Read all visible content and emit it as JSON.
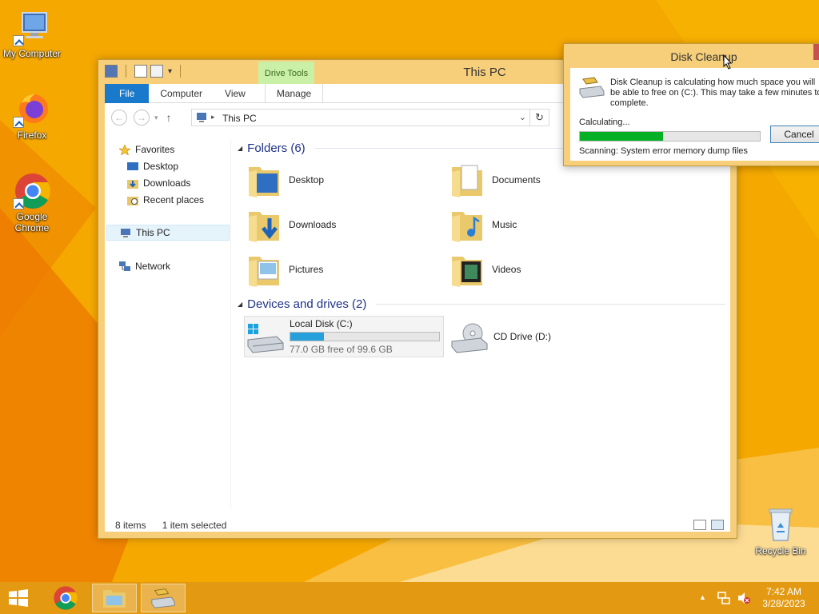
{
  "desktop": {
    "icons": [
      {
        "label": "My Computer",
        "icon": "computer-icon"
      },
      {
        "label": "Firefox",
        "icon": "firefox-icon"
      },
      {
        "label": "Google Chrome",
        "icon": "chrome-icon"
      },
      {
        "label": "Recycle Bin",
        "icon": "recycle-bin-icon"
      }
    ]
  },
  "explorer": {
    "title": "This PC",
    "contextual_tab": "Drive Tools",
    "ribbon_tabs": [
      "File",
      "Computer",
      "View",
      "Manage"
    ],
    "address": {
      "crumb": "This PC"
    },
    "nav": {
      "favorites": "Favorites",
      "favorite_items": [
        "Desktop",
        "Downloads",
        "Recent places"
      ],
      "this_pc": "This PC",
      "network": "Network"
    },
    "folders_header": "Folders (6)",
    "folders": [
      "Desktop",
      "Documents",
      "Downloads",
      "Music",
      "Pictures",
      "Videos"
    ],
    "devices_header": "Devices and drives (2)",
    "drives": [
      {
        "name": "Local Disk (C:)",
        "free_text": "77.0 GB free of 99.6 GB",
        "used_fraction": 0.227
      },
      {
        "name": "CD Drive (D:)"
      }
    ],
    "status": {
      "items": "8 items",
      "selected": "1 item selected"
    }
  },
  "dialog": {
    "title": "Disk Cleanup",
    "message": "Disk Cleanup is calculating how much space you will be able to free on  (C:). This may take a few minutes to complete.",
    "calculating": "Calculating...",
    "progress_fraction": 0.46,
    "cancel": "Cancel",
    "scanning": "Scanning:   System error memory dump files"
  },
  "taskbar": {
    "time": "7:42 AM",
    "date": "3/28/2023",
    "colors": {
      "accent": "#f5a500",
      "file_tab": "#1979ca",
      "progress": "#06b025",
      "disk_bar": "#26a0da"
    }
  }
}
